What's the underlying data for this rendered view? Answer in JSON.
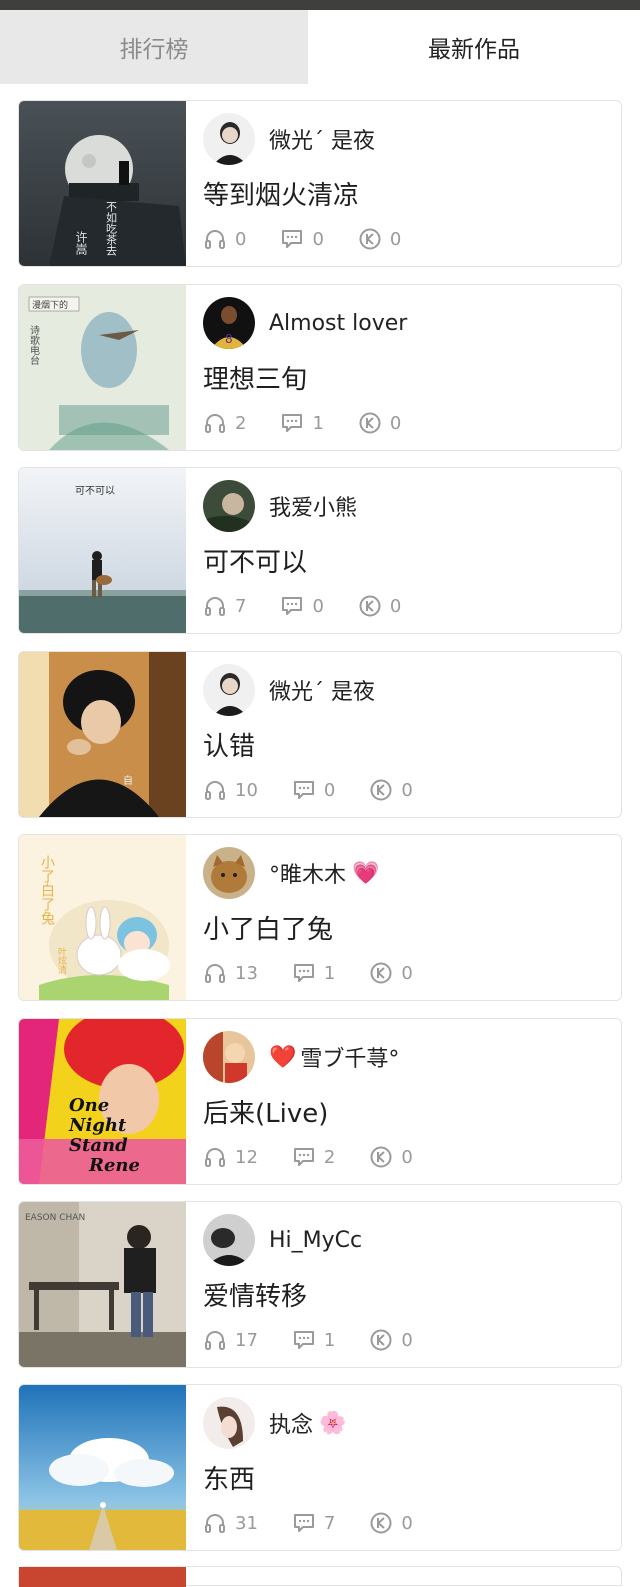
{
  "tabs": [
    {
      "label": "排行榜",
      "active": false
    },
    {
      "label": "最新作品",
      "active": true
    }
  ],
  "works": [
    {
      "author": "微光ˊ 是夜",
      "author_emoji": "",
      "title": "等到烟火清凉",
      "listens": "0",
      "comments": "0",
      "karaoke": "0"
    },
    {
      "author": "Almost lover",
      "author_emoji": "",
      "title": "理想三旬",
      "listens": "2",
      "comments": "1",
      "karaoke": "0"
    },
    {
      "author": "我爱小熊",
      "author_emoji": "",
      "title": "可不可以",
      "listens": "7",
      "comments": "0",
      "karaoke": "0"
    },
    {
      "author": "微光ˊ 是夜",
      "author_emoji": "",
      "title": "认错",
      "listens": "10",
      "comments": "0",
      "karaoke": "0"
    },
    {
      "author": "°睢木木",
      "author_emoji": "💗",
      "title": "小了白了兔",
      "listens": "13",
      "comments": "1",
      "karaoke": "0"
    },
    {
      "author": "雪ブ千荨°",
      "author_emoji": "❤️",
      "title": "后来(Live)",
      "listens": "12",
      "comments": "2",
      "karaoke": "0"
    },
    {
      "author": "Hi_MyCc",
      "author_emoji": "",
      "title": "爱情转移",
      "listens": "17",
      "comments": "1",
      "karaoke": "0"
    },
    {
      "author": "执念",
      "author_emoji": "🌸",
      "title": "东西",
      "listens": "31",
      "comments": "7",
      "karaoke": "0"
    }
  ],
  "cover_text": {
    "c1_a": "许嵩",
    "c1_b": "不如吃茶去",
    "c2_a": "漫烟下的",
    "c2_b": "诗歌电台",
    "c3_a": "可不可以",
    "c4_a": "自",
    "c5_a": "小了白了兔",
    "c5_b": "叶炫清",
    "c6_a": "One",
    "c6_b": "Night",
    "c6_c": "Stand",
    "c6_d": "Rene",
    "c7_a": "EASON CHAN"
  },
  "icons": {
    "listens": "headphones-icon",
    "comments": "comment-icon",
    "karaoke": "k-song-icon"
  },
  "colors": {
    "icon_gray": "#9a9a9a",
    "tab_inactive_bg": "#e8e8e8",
    "status_bar": "#3f3f3d"
  }
}
